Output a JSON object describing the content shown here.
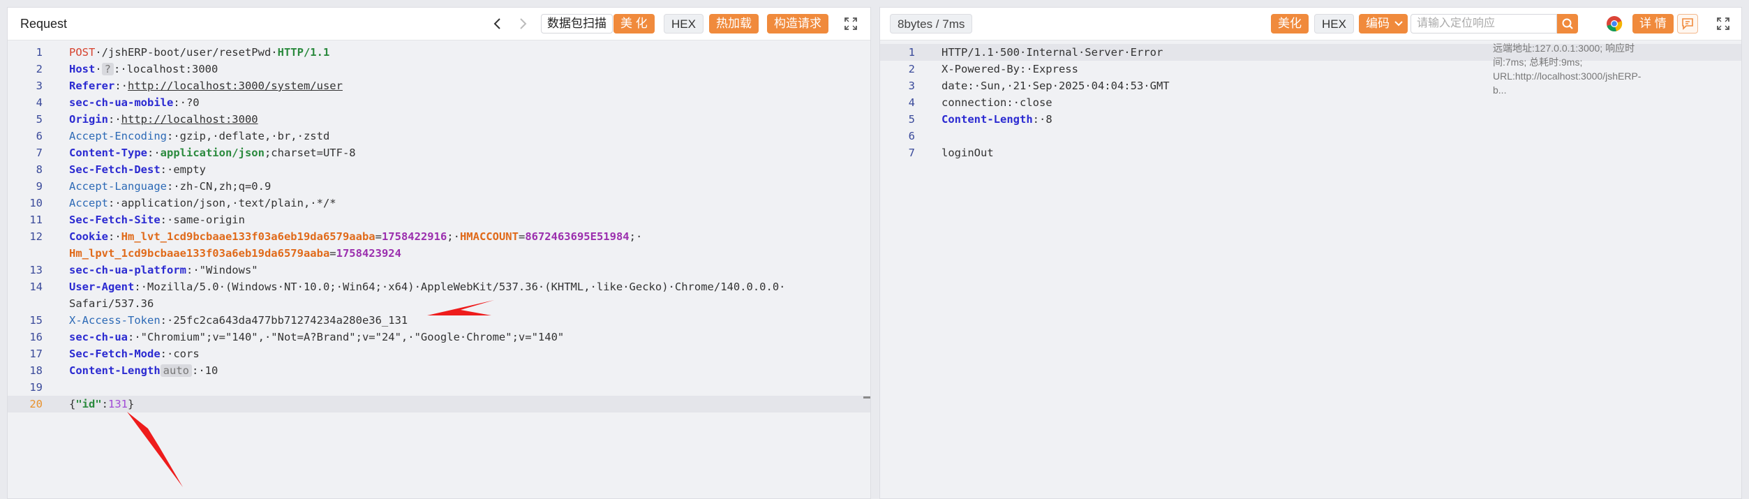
{
  "request": {
    "title": "Request",
    "scan_label": "数据包扫描",
    "beautify_label": "美 化",
    "hex_label": "HEX",
    "hot_reload_label": "热加载",
    "construct_label": "构造请求",
    "lines": [
      {
        "n": "1",
        "parts": [
          [
            "k-method",
            "POST"
          ],
          [
            "",
            "·/jshERP-boot/user/resetPwd·"
          ],
          [
            "k-proto",
            "HTTP/1.1"
          ]
        ]
      },
      {
        "n": "2",
        "parts": [
          [
            "k-hdr",
            "Host"
          ],
          [
            "",
            "·"
          ],
          [
            "pill",
            "?"
          ],
          [
            "",
            ":·localhost:3000"
          ]
        ]
      },
      {
        "n": "3",
        "parts": [
          [
            "k-hdr",
            "Referer"
          ],
          [
            "",
            ":·"
          ],
          [
            "k-link",
            "http://localhost:3000/system/user"
          ]
        ]
      },
      {
        "n": "4",
        "parts": [
          [
            "k-hdr",
            "sec-ch-ua-mobile"
          ],
          [
            "",
            ":·?0"
          ]
        ]
      },
      {
        "n": "5",
        "parts": [
          [
            "k-hdr",
            "Origin"
          ],
          [
            "",
            ":·"
          ],
          [
            "k-link",
            "http://localhost:3000"
          ]
        ]
      },
      {
        "n": "6",
        "parts": [
          [
            "k-hdr2",
            "Accept-Encoding"
          ],
          [
            "",
            ":·gzip,·deflate,·br,·zstd"
          ]
        ]
      },
      {
        "n": "7",
        "parts": [
          [
            "k-hdr",
            "Content-Type"
          ],
          [
            "",
            ":·"
          ],
          [
            "k-ctype",
            "application/json"
          ],
          [
            "",
            ";charset=UTF-8"
          ]
        ]
      },
      {
        "n": "8",
        "parts": [
          [
            "k-hdr",
            "Sec-Fetch-Dest"
          ],
          [
            "",
            ":·empty"
          ]
        ]
      },
      {
        "n": "9",
        "parts": [
          [
            "k-hdr2",
            "Accept-Language"
          ],
          [
            "",
            ":·zh-CN,zh;q=0.9"
          ]
        ]
      },
      {
        "n": "10",
        "parts": [
          [
            "k-hdr2",
            "Accept"
          ],
          [
            "",
            ":·application/json,·text/plain,·*/*"
          ]
        ]
      },
      {
        "n": "11",
        "parts": [
          [
            "k-hdr",
            "Sec-Fetch-Site"
          ],
          [
            "",
            ":·same-origin"
          ]
        ]
      },
      {
        "n": "12",
        "parts": [
          [
            "k-hdr",
            "Cookie"
          ],
          [
            "",
            ":·"
          ],
          [
            "k-ckname",
            "Hm_lvt_1cd9bcbaae133f03a6eb19da6579aaba"
          ],
          [
            "",
            "="
          ],
          [
            "k-ckval",
            "1758422916"
          ],
          [
            "",
            ";·"
          ],
          [
            "k-ckname",
            "HMACCOUNT"
          ],
          [
            "",
            "="
          ],
          [
            "k-ckval",
            "8672463695E51984"
          ],
          [
            "",
            ";·"
          ]
        ]
      },
      {
        "n": "",
        "parts": [
          [
            "k-ckname",
            "Hm_lpvt_1cd9bcbaae133f03a6eb19da6579aaba"
          ],
          [
            "",
            "="
          ],
          [
            "k-ckval",
            "1758423924"
          ]
        ]
      },
      {
        "n": "13",
        "parts": [
          [
            "k-hdr",
            "sec-ch-ua-platform"
          ],
          [
            "",
            ":·\"Windows\""
          ]
        ]
      },
      {
        "n": "14",
        "parts": [
          [
            "k-hdr",
            "User-Agent"
          ],
          [
            "",
            ":·Mozilla/5.0·(Windows·NT·10.0;·Win64;·x64)·AppleWebKit/537.36·(KHTML,·like·Gecko)·Chrome/140.0.0.0·"
          ]
        ]
      },
      {
        "n": "",
        "parts": [
          [
            "",
            "Safari/537.36"
          ]
        ]
      },
      {
        "n": "15",
        "parts": [
          [
            "k-hdr2",
            "X-Access-Token"
          ],
          [
            "",
            ":·25fc2ca643da477bb71274234a280e36_131"
          ]
        ]
      },
      {
        "n": "16",
        "parts": [
          [
            "k-hdr",
            "sec-ch-ua"
          ],
          [
            "",
            ":·\"Chromium\";v=\"140\",·\"Not=A?Brand\";v=\"24\",·\"Google·Chrome\";v=\"140\""
          ]
        ]
      },
      {
        "n": "17",
        "parts": [
          [
            "k-hdr",
            "Sec-Fetch-Mode"
          ],
          [
            "",
            ":·cors"
          ]
        ]
      },
      {
        "n": "18",
        "parts": [
          [
            "k-hdr",
            "Content-Length"
          ],
          [
            "pill",
            "auto"
          ],
          [
            "",
            ":·10"
          ]
        ]
      },
      {
        "n": "19",
        "parts": []
      },
      {
        "n": "20",
        "active": true,
        "highlight": true,
        "parts": [
          [
            "",
            "{"
          ],
          [
            "k-key",
            "\"id\""
          ],
          [
            "",
            ":"
          ],
          [
            "k-num",
            "131"
          ],
          [
            "",
            "}"
          ]
        ]
      }
    ]
  },
  "response": {
    "size_label": "8bytes / 7ms",
    "beautify_label": "美化",
    "hex_label": "HEX",
    "encoding_label": "编码",
    "search_placeholder": "请输入定位响应",
    "details_label": "详 情",
    "side_info": "远端地址:127.0.0.1:3000; 响应时间:7ms; 总耗时:9ms; URL:http://localhost:3000/jshERP-b...",
    "lines": [
      {
        "n": "1",
        "parts": [
          [
            "",
            "HTTP/1.1·500·Internal·Server·Error"
          ]
        ],
        "highlight": true
      },
      {
        "n": "2",
        "parts": [
          [
            "",
            "X-Powered-By:·Express"
          ]
        ]
      },
      {
        "n": "3",
        "parts": [
          [
            "",
            "date:·Sun,·21·Sep·2025·04:04:53·GMT"
          ]
        ]
      },
      {
        "n": "4",
        "parts": [
          [
            "",
            "connection:·close"
          ]
        ]
      },
      {
        "n": "5",
        "parts": [
          [
            "k-hdr",
            "Content-Length"
          ],
          [
            "",
            ":·8"
          ]
        ]
      },
      {
        "n": "6",
        "parts": []
      },
      {
        "n": "7",
        "parts": [
          [
            "",
            "loginOut"
          ]
        ]
      }
    ]
  },
  "colors": {
    "accent": "#f08a3c",
    "header_key": "#2b2ad1",
    "line_number": "#3a4a9a",
    "arrow": "#ee1c1c"
  }
}
